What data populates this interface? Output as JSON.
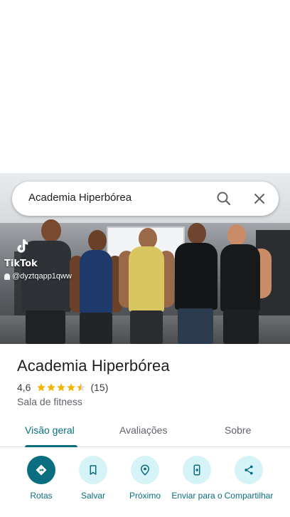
{
  "search": {
    "query": "Academia Hiperbórea"
  },
  "photo": {
    "watermark_brand": "TikTok",
    "watermark_user": "@dyztqapp1qww"
  },
  "place": {
    "name": "Academia Hiperbórea",
    "rating": "4,6",
    "rating_stars": 4.5,
    "review_count": "(15)",
    "category": "Sala de fitness"
  },
  "tabs": [
    {
      "label": "Visão geral",
      "active": true
    },
    {
      "label": "Avaliações",
      "active": false
    },
    {
      "label": "Sobre",
      "active": false
    }
  ],
  "actions": [
    {
      "label": "Rotas",
      "icon": "directions-icon"
    },
    {
      "label": "Salvar",
      "icon": "bookmark-icon"
    },
    {
      "label": "Próximo",
      "icon": "nearby-icon"
    },
    {
      "label": "Enviar para o",
      "icon": "send-to-phone-icon"
    },
    {
      "label": "Compartilhar",
      "icon": "share-icon"
    }
  ],
  "colors": {
    "accent": "#0b6e7f",
    "accent_light": "#d6f3f8",
    "star": "#f4b400"
  }
}
